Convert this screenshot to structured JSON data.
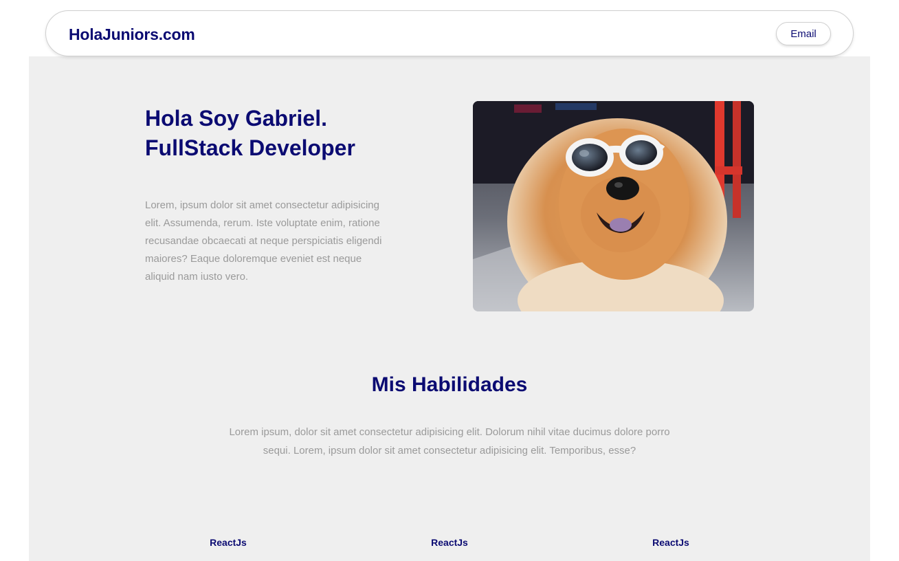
{
  "navbar": {
    "brand": "HolaJuniors.com",
    "email_label": "Email"
  },
  "hero": {
    "title_line1": "Hola Soy Gabriel.",
    "title_line2": "FullStack Developer",
    "description": "Lorem, ipsum dolor sit amet consectetur adipisicing elit. Assumenda, rerum. Iste voluptate enim, ratione recusandae obcaecati at neque perspiciatis eligendi maiores? Eaque doloremque eveniet est neque aliquid nam iusto vero.",
    "image_alt": "dog-with-sunglasses-photo"
  },
  "skills": {
    "title": "Mis Habilidades",
    "description": "Lorem ipsum, dolor sit amet consectetur adipisicing elit. Dolorum nihil vitae ducimus dolore porro sequi. Lorem, ipsum dolor sit amet consectetur adipisicing elit. Temporibus, esse?",
    "items": [
      {
        "label": "ReactJs"
      },
      {
        "label": "ReactJs"
      },
      {
        "label": "ReactJs"
      }
    ]
  },
  "colors": {
    "primary": "#0b0b72",
    "muted_text": "#9a9a9a",
    "background": "#efefef"
  }
}
